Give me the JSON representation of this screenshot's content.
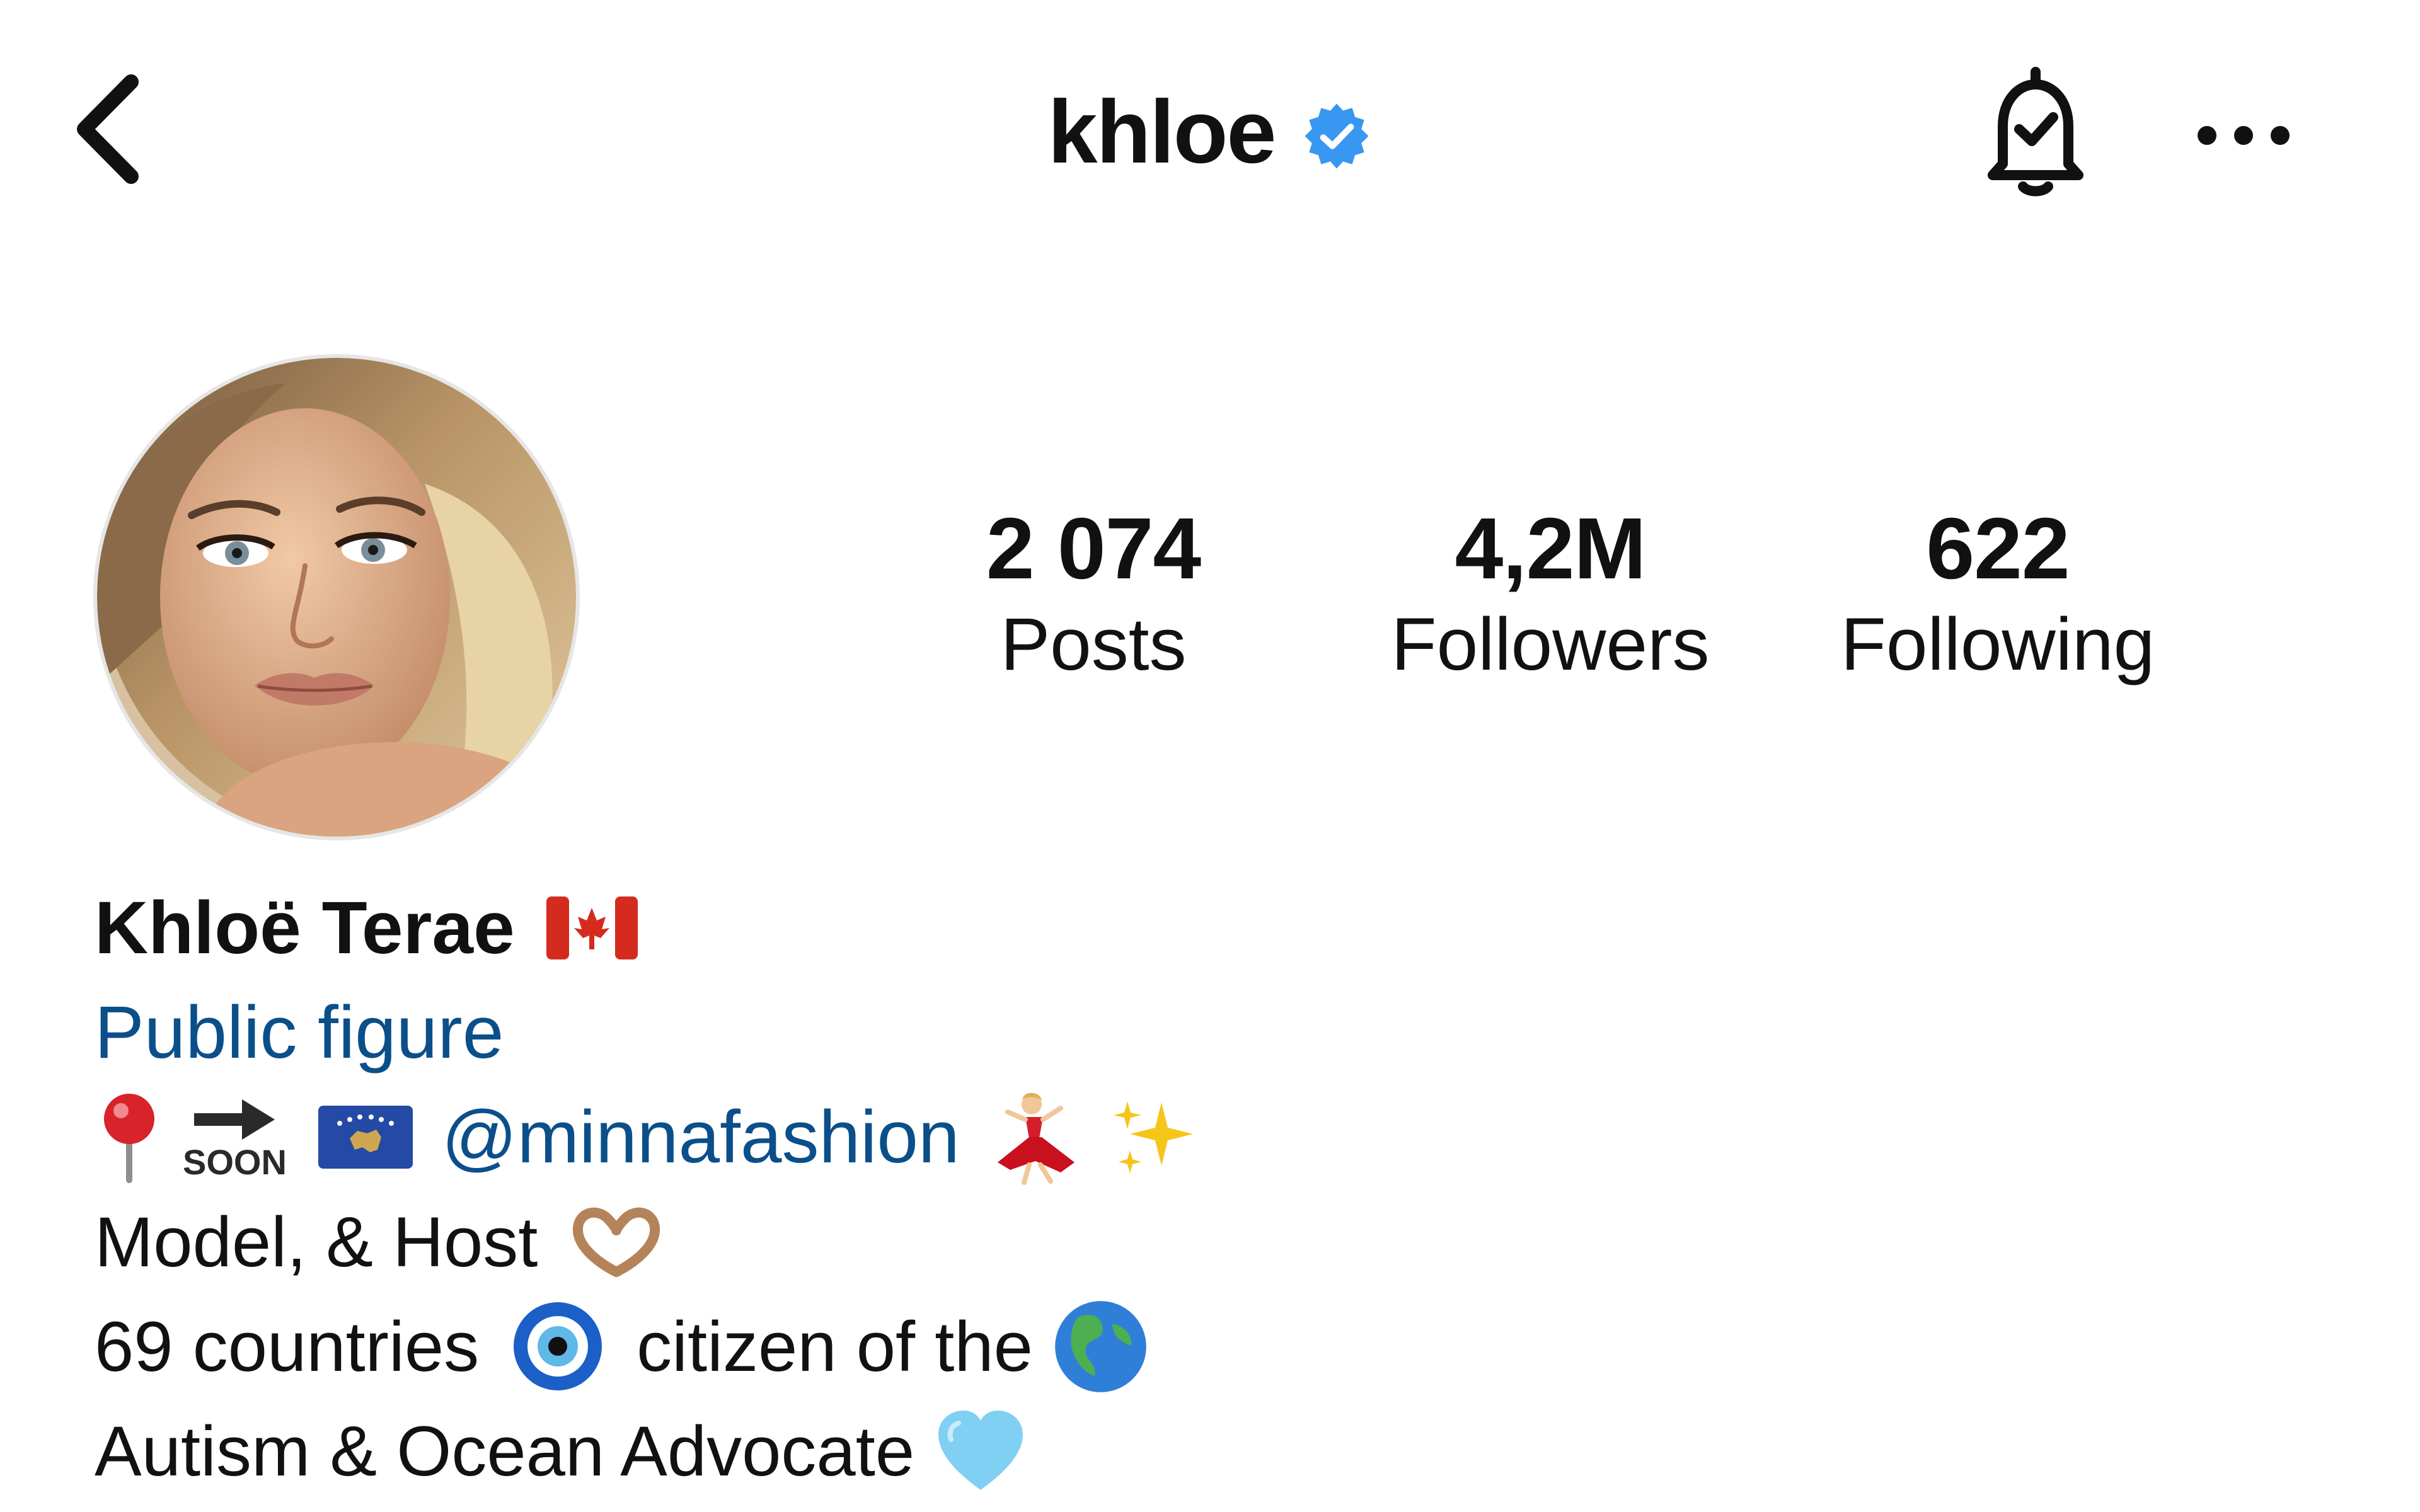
{
  "header": {
    "username": "khloe",
    "verified": true
  },
  "stats": [
    {
      "value": "2 074",
      "label": "Posts"
    },
    {
      "value": "4,2M",
      "label": "Followers"
    },
    {
      "value": "622",
      "label": "Following"
    }
  ],
  "bio": {
    "name": "Khloë Terae",
    "category": "Public figure",
    "line1": {
      "soon_label": "SOON",
      "mention": "@minnafashion"
    },
    "line2": "Model, & Host",
    "line3": {
      "part1": "69 countries",
      "part2": "citizen of the"
    },
    "line4": "Autism & Ocean Advocate"
  },
  "icons": {
    "back": "chevron-left-icon",
    "verified": "verified-badge-icon",
    "notifications": "bell-check-icon",
    "more": "more-horizontal-icon"
  },
  "colors": {
    "verified_blue": "#3897f0",
    "link_blue": "#0b4f8a",
    "text": "#111111"
  }
}
